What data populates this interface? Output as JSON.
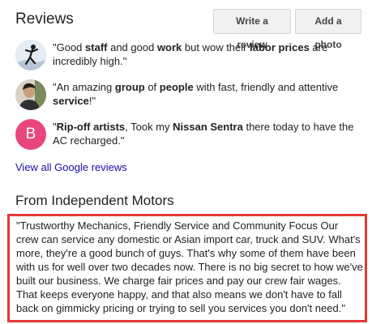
{
  "reviews_section": {
    "title": "Reviews",
    "write_review_label": "Write a review",
    "add_photo_label": "Add a photo",
    "items": [
      {
        "avatar_type": "photo-silhouette",
        "segments": [
          {
            "t": "\"Good ",
            "b": false
          },
          {
            "t": "staff",
            "b": true
          },
          {
            "t": " and good ",
            "b": false
          },
          {
            "t": "work",
            "b": true
          },
          {
            "t": " but wow their ",
            "b": false
          },
          {
            "t": "labor prices",
            "b": true
          },
          {
            "t": " are incredibly high.\"",
            "b": false
          }
        ]
      },
      {
        "avatar_type": "photo-person",
        "segments": [
          {
            "t": "\"An amazing ",
            "b": false
          },
          {
            "t": "group",
            "b": true
          },
          {
            "t": " of ",
            "b": false
          },
          {
            "t": "people",
            "b": true
          },
          {
            "t": " with fast, friendly and attentive ",
            "b": false
          },
          {
            "t": "service",
            "b": true
          },
          {
            "t": "!\"",
            "b": false
          }
        ]
      },
      {
        "avatar_type": "letter",
        "avatar_letter": "B",
        "avatar_color": "#e8467c",
        "segments": [
          {
            "t": "\"",
            "b": false
          },
          {
            "t": "Rip-off artists",
            "b": true
          },
          {
            "t": ", Took my ",
            "b": false
          },
          {
            "t": "Nissan Sentra",
            "b": true
          },
          {
            "t": " there today to have the AC recharged.\"",
            "b": false
          }
        ]
      }
    ],
    "view_all_label": "View all Google reviews"
  },
  "business_description": {
    "title": "From Independent Motors",
    "text": "\"Trustworthy Mechanics, Friendly Service and Community Focus Our crew can service any domestic or Asian import car, truck and SUV. What's more, they're a good bunch of guys. That's why some of them have been with us for well over two decades now. There is no big secret to how we've built our business. We charge fair prices and pay our crew fair wages. That keeps everyone happy, and that also means we don't have to fall back on gimmicky pricing or trying to sell you services you don't need.\"",
    "highlight_color": "#e53935"
  },
  "colors": {
    "link": "#1a0dab",
    "button_bg": "#f1f1f1",
    "text": "#222222"
  }
}
